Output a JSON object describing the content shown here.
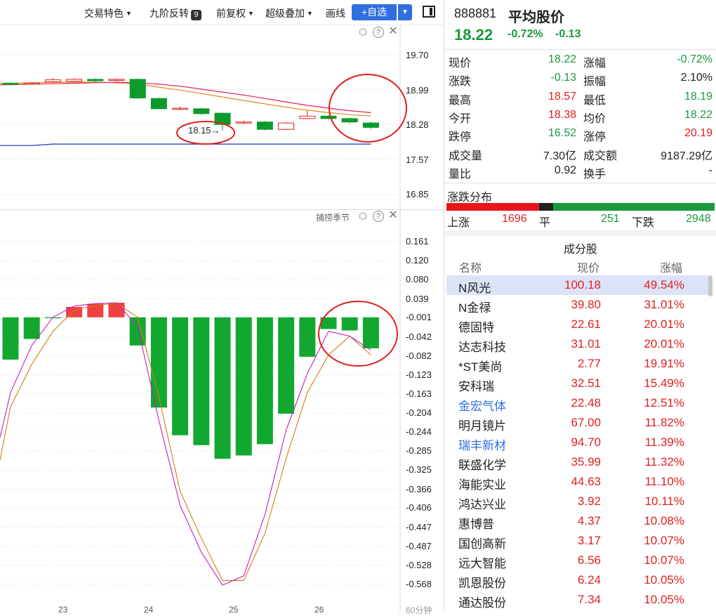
{
  "toolbar": {
    "items": [
      {
        "label": "交易特色",
        "dropdown": true
      },
      {
        "label": "九阶反转",
        "badge": "9"
      },
      {
        "label": "前复权",
        "dropdown": true
      },
      {
        "label": "超级叠加",
        "dropdown": true
      },
      {
        "label": "画线"
      }
    ],
    "fav_button": "+自选"
  },
  "price_chart": {
    "y_ticks": [
      "19.70",
      "18.99",
      "18.28",
      "17.57",
      "16.85"
    ],
    "annotation": "18.15"
  },
  "osc_chart": {
    "label": "捕捞季节",
    "y_ticks": [
      "0.161",
      "0.120",
      "0.080",
      "0.039",
      "-0.001",
      "-0.042",
      "-0.082",
      "-0.123",
      "-0.163",
      "-0.204",
      "-0.244",
      "-0.285",
      "-0.325",
      "-0.366",
      "-0.406",
      "-0.447",
      "-0.487",
      "-0.528",
      "-0.568"
    ],
    "bar_values": [
      -0.09,
      -0.046,
      -0.002,
      0.022,
      0.029,
      0.031,
      -0.06,
      -0.192,
      -0.251,
      -0.272,
      -0.301,
      -0.294,
      -0.27,
      -0.205,
      -0.084,
      -0.025,
      -0.028,
      -0.066
    ],
    "bottom_labels": [
      "23",
      "24",
      "25",
      "26"
    ],
    "period_label": "60分钟"
  },
  "stock": {
    "code": "888881",
    "name": "平均股价",
    "price": "18.22",
    "change_pct": "-0.72%",
    "change": "-0.13"
  },
  "quote": [
    {
      "l": "现价",
      "v": "18.22",
      "c": "green",
      "l2": "涨幅",
      "v2": "-0.72%",
      "c2": "green"
    },
    {
      "l": "涨跌",
      "v": "-0.13",
      "c": "green",
      "l2": "振幅",
      "v2": "2.10%",
      "c2": "dark"
    },
    {
      "l": "最高",
      "v": "18.57",
      "c": "red",
      "l2": "最低",
      "v2": "18.19",
      "c2": "green"
    },
    {
      "l": "今开",
      "v": "18.38",
      "c": "red",
      "l2": "均价",
      "v2": "18.22",
      "c2": "green"
    },
    {
      "l": "跌停",
      "v": "16.52",
      "c": "green",
      "l2": "涨停",
      "v2": "20.19",
      "c2": "red"
    },
    {
      "l": "成交量",
      "v": "7.30亿",
      "c": "dark",
      "l2": "成交额",
      "v2": "9187.29亿",
      "c2": "dark"
    },
    {
      "l": "量比",
      "v": "0.92",
      "c": "dark",
      "l2": "换手",
      "v2": "-",
      "c2": "dark"
    }
  ],
  "distribution": {
    "title": "涨跌分布",
    "up_label": "上涨",
    "up_count": 1696,
    "flat_label": "平",
    "flat_count": 251,
    "down_label": "下跌",
    "down_count": 2948,
    "colors": {
      "up": "#e8141c",
      "flat": "#222222",
      "down": "#1a9a3c"
    }
  },
  "constituents": {
    "title": "成分股",
    "headers": {
      "name": "名称",
      "price": "现价",
      "pct": "涨幅"
    },
    "rows": [
      {
        "name": "N风光",
        "price": "100.18",
        "pct": "49.54%",
        "selected": true,
        "blue": false
      },
      {
        "name": "N金禄",
        "price": "39.80",
        "pct": "31.01%",
        "blue": false
      },
      {
        "name": "德固特",
        "price": "22.61",
        "pct": "20.01%",
        "blue": false
      },
      {
        "name": "达志科技",
        "price": "31.01",
        "pct": "20.01%",
        "blue": false
      },
      {
        "name": "*ST美尚",
        "price": "2.77",
        "pct": "19.91%",
        "blue": false
      },
      {
        "name": "安科瑞",
        "price": "32.51",
        "pct": "15.49%",
        "blue": false
      },
      {
        "name": "金宏气体",
        "price": "22.48",
        "pct": "12.51%",
        "blue": true
      },
      {
        "name": "明月镜片",
        "price": "67.00",
        "pct": "11.82%",
        "blue": false
      },
      {
        "name": "瑞丰新材",
        "price": "94.70",
        "pct": "11.39%",
        "blue": true
      },
      {
        "name": "联盛化学",
        "price": "35.99",
        "pct": "11.32%",
        "blue": false
      },
      {
        "name": "海能实业",
        "price": "44.63",
        "pct": "11.10%",
        "blue": false
      },
      {
        "name": "鸿达兴业",
        "price": "3.92",
        "pct": "10.11%",
        "blue": false
      },
      {
        "name": "惠博普",
        "price": "4.37",
        "pct": "10.08%",
        "blue": false
      },
      {
        "name": "国创高新",
        "price": "3.17",
        "pct": "10.07%",
        "blue": false
      },
      {
        "name": "远大智能",
        "price": "6.56",
        "pct": "10.07%",
        "blue": false
      },
      {
        "name": "凯恩股份",
        "price": "6.24",
        "pct": "10.05%",
        "blue": false
      },
      {
        "name": "通达股份",
        "price": "7.34",
        "pct": "10.05%",
        "blue": false
      }
    ]
  },
  "chart_data": [
    {
      "type": "candlestick",
      "y_ticks": [
        19.7,
        18.99,
        18.28,
        17.57,
        16.85
      ],
      "ylim": [
        16.6,
        20.2
      ],
      "candles": [
        {
          "o": 19.12,
          "c": 19.1,
          "h": 19.14,
          "l": 19.08
        },
        {
          "o": 19.1,
          "c": 19.12,
          "h": 19.14,
          "l": 19.08
        },
        {
          "o": 19.15,
          "c": 19.19,
          "h": 19.23,
          "l": 19.12
        },
        {
          "o": 19.16,
          "c": 19.2,
          "h": 19.22,
          "l": 19.14
        },
        {
          "o": 19.2,
          "c": 19.17,
          "h": 19.22,
          "l": 19.15
        },
        {
          "o": 19.18,
          "c": 19.2,
          "h": 19.22,
          "l": 19.16
        },
        {
          "o": 19.2,
          "c": 18.82,
          "h": 19.22,
          "l": 18.8
        },
        {
          "o": 18.81,
          "c": 18.6,
          "h": 18.83,
          "l": 18.6
        },
        {
          "o": 18.61,
          "c": 18.61,
          "h": 18.65,
          "l": 18.57
        },
        {
          "o": 18.6,
          "c": 18.5,
          "h": 18.62,
          "l": 18.48
        },
        {
          "o": 18.51,
          "c": 18.28,
          "h": 18.52,
          "l": 18.15
        },
        {
          "o": 18.31,
          "c": 18.33,
          "h": 18.36,
          "l": 18.28
        },
        {
          "o": 18.33,
          "c": 18.18,
          "h": 18.35,
          "l": 18.16
        },
        {
          "o": 18.18,
          "c": 18.31,
          "h": 18.33,
          "l": 18.16
        },
        {
          "o": 18.4,
          "c": 18.45,
          "h": 18.56,
          "l": 18.38
        },
        {
          "o": 18.45,
          "c": 18.4,
          "h": 18.47,
          "l": 18.38
        },
        {
          "o": 18.4,
          "c": 18.33,
          "h": 18.42,
          "l": 18.3
        },
        {
          "o": 18.31,
          "c": 18.22,
          "h": 18.33,
          "l": 18.19
        }
      ],
      "ma_red": [
        19.09,
        19.1,
        19.11,
        19.12,
        19.13,
        19.14,
        19.13,
        19.1,
        19.06,
        19.0,
        18.94,
        18.88,
        18.81,
        18.74,
        18.67,
        18.61,
        18.56,
        18.52
      ],
      "ma_orange": [
        19.12,
        19.13,
        19.14,
        19.14,
        19.14,
        19.13,
        19.1,
        19.04,
        18.98,
        18.91,
        18.84,
        18.77,
        18.7,
        18.63,
        18.57,
        18.52,
        18.48,
        18.45
      ],
      "ma_blue": [
        17.85,
        17.85,
        17.88,
        17.88,
        17.88,
        17.88,
        17.88,
        17.88,
        17.88,
        17.88,
        17.88,
        17.88,
        17.88,
        17.88,
        17.88,
        17.88,
        17.88,
        17.88
      ],
      "colors": {
        "up": "#e02020",
        "down": "#0c9a2c",
        "ma_red": "#e0205a",
        "ma_orange": "#e08a10",
        "ma_blue": "#1530c0"
      }
    },
    {
      "type": "bar",
      "ylim": [
        -0.59,
        0.18
      ],
      "line_magenta": [
        -0.16,
        -0.06,
        0.0,
        0.024,
        0.029,
        0.031,
        -0.02,
        -0.22,
        -0.4,
        -0.5,
        -0.57,
        -0.55,
        -0.42,
        -0.24,
        -0.12,
        -0.03,
        -0.04,
        -0.07
      ],
      "line_orange": [
        -0.19,
        -0.1,
        -0.03,
        0.015,
        0.025,
        0.03,
        0.0,
        -0.17,
        -0.37,
        -0.47,
        -0.56,
        -0.56,
        -0.46,
        -0.3,
        -0.16,
        -0.08,
        -0.04,
        -0.08
      ],
      "colors": {
        "pos": "#f04040",
        "neg": "#12a830",
        "magenta": "#c020c0",
        "orange": "#d87a10"
      }
    }
  ]
}
